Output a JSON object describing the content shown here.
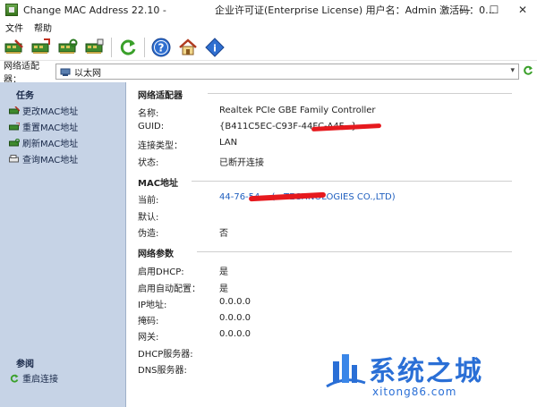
{
  "window": {
    "title": "Change MAC Address 22.10 -",
    "license_info": "企业许可证(Enterprise License) 用户名：Admin 激活码：0...",
    "min_glyph": "—",
    "max_glyph": "☐",
    "close_glyph": "✕"
  },
  "menu": [
    "文件",
    "帮助"
  ],
  "adapter": {
    "label": "网络适配器：",
    "selected": "以太网"
  },
  "tasks": {
    "title": "任务",
    "items": [
      "更改MAC地址",
      "重置MAC地址",
      "刷新MAC地址",
      "查询MAC地址"
    ]
  },
  "reference": {
    "title": "参阅",
    "items": [
      "重启连接"
    ]
  },
  "network_adapter": {
    "heading": "网络适配器",
    "name_label": "名称:",
    "name_value": "Realtek PCIe GBE Family Controller",
    "guid_label": "GUID:",
    "guid_value": "{B411C5EC-C93F-44FC-A4F...}",
    "conn_type_label": "连接类型：",
    "conn_type_value": "LAN",
    "status_label": "状态:",
    "status_value": "已断开连接"
  },
  "mac": {
    "heading": "MAC地址",
    "current_label": "当前:",
    "current_value": "44-76-54-...(...TECHNOLOGIES CO.,LTD)",
    "default_label": "默认:",
    "fake_label": "伪造:",
    "fake_value": "否"
  },
  "net_params": {
    "heading": "网络参数",
    "dhcp_label": "启用DHCP:",
    "dhcp_value": "是",
    "autocfg_label": "启用自动配置：",
    "autocfg_value": "是",
    "ip_label": "IP地址:",
    "ip_value": "0.0.0.0",
    "mask_label": "掩码:",
    "mask_value": "0.0.0.0",
    "gateway_label": "网关:",
    "gateway_value": "0.0.0.0",
    "dhcp_server_label": "DHCP服务器:",
    "dns_server_label": "DNS服务器:"
  },
  "watermark": {
    "text": "系统之城",
    "url": "xitong86.com"
  }
}
